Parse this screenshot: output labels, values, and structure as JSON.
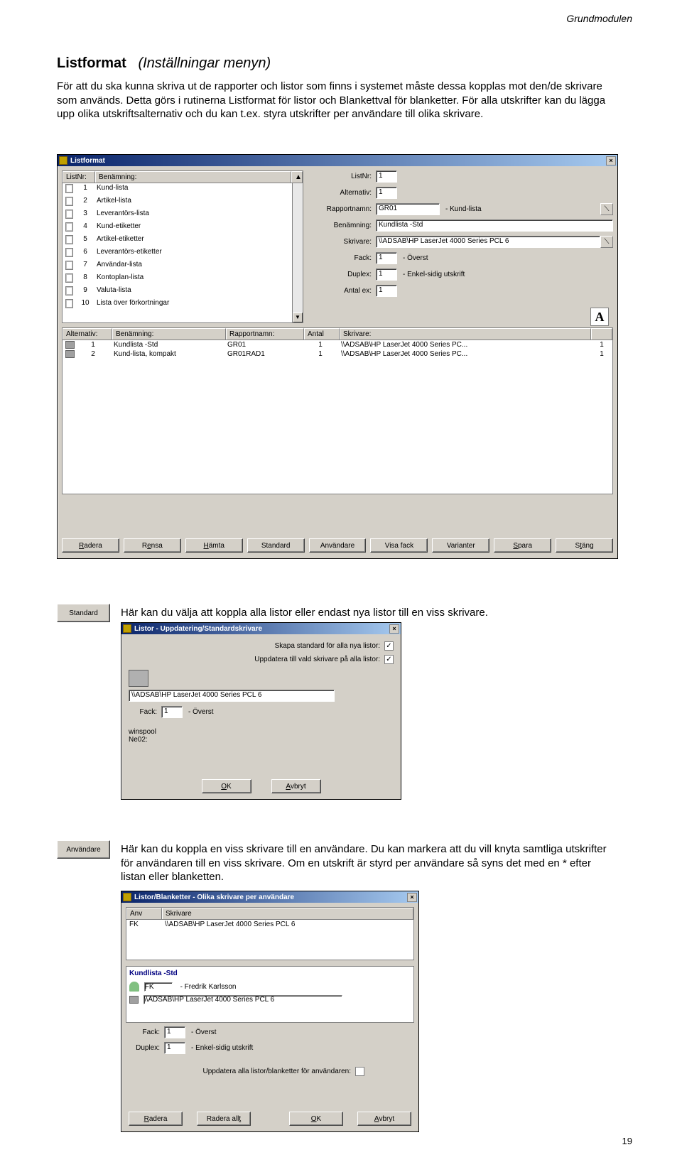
{
  "header": "Grundmodulen",
  "page_number": "19",
  "title": {
    "main": "Listformat",
    "paren": "(Inställningar menyn)"
  },
  "para1": "För att du ska kunna skriva ut de rapporter och listor som finns i systemet måste dessa kopplas mot den/de skrivare som används. Detta görs i rutinerna Listformat för listor och Blankettval för blanketter. För alla utskrifter kan du lägga upp olika utskriftsalternativ och du kan t.ex. styra utskrifter per användare till olika skrivare.",
  "para2": "Här kan du välja att koppla alla listor eller endast nya listor till en viss skrivare.",
  "para3": "Här kan du koppla en viss skrivare till en användare. Du kan markera att du vill knyta samtliga utskrifter för användaren till en viss skrivare. Om en utskrift är styrd per användare så syns det med en * efter listan eller blanketten.",
  "badge_standard": "Standard",
  "badge_anvandare": "Användare",
  "win1": {
    "title": "Listformat",
    "list_head": [
      "ListNr:",
      "Benämning:"
    ],
    "list_rows": [
      [
        "1",
        "Kund-lista"
      ],
      [
        "2",
        "Artikel-lista"
      ],
      [
        "3",
        "Leverantörs-lista"
      ],
      [
        "4",
        "Kund-etiketter"
      ],
      [
        "5",
        "Artikel-etiketter"
      ],
      [
        "6",
        "Leverantörs-etiketter"
      ],
      [
        "7",
        "Användar-lista"
      ],
      [
        "8",
        "Kontoplan-lista"
      ],
      [
        "9",
        "Valuta-lista"
      ],
      [
        "10",
        "Lista över förkortningar"
      ]
    ],
    "form": {
      "listnr_lbl": "ListNr:",
      "listnr_val": "1",
      "alternativ_lbl": "Alternativ:",
      "alternativ_val": "1",
      "rapportnamn_lbl": "Rapportnamn:",
      "rapportnamn_val": "GR01",
      "rapportnamn_desc": "- Kund-lista",
      "benamning_lbl": "Benämning:",
      "benamning_val": "Kundlista -Std",
      "skrivare_lbl": "Skrivare:",
      "skrivare_val": "\\\\ADSAB\\HP LaserJet 4000 Series PCL 6",
      "fack_lbl": "Fack:",
      "fack_val": "1",
      "fack_desc": "- Överst",
      "duplex_lbl": "Duplex:",
      "duplex_val": "1",
      "duplex_desc": "- Enkel-sidig utskrift",
      "antal_lbl": "Antal ex:",
      "antal_val": "1"
    },
    "grid2_head": [
      "Alternativ:",
      "Benämning:",
      "Rapportnamn:",
      "Antal",
      "Skrivare:"
    ],
    "grid2_rows": [
      [
        "1",
        "Kundlista -Std",
        "GR01",
        "1",
        "\\\\ADSAB\\HP LaserJet 4000 Series PC...",
        "1"
      ],
      [
        "2",
        "Kund-lista, kompakt",
        "GR01RAD1",
        "1",
        "\\\\ADSAB\\HP LaserJet 4000 Series PC...",
        "1"
      ]
    ],
    "buttons": [
      "Radera",
      "Rensa",
      "Hämta",
      "Standard",
      "Användare",
      "Visa fack",
      "Varianter",
      "Spara",
      "Stäng"
    ]
  },
  "win2": {
    "title": "Listor - Uppdatering/Standardskrivare",
    "cb1": "Skapa standard för alla nya listor:",
    "cb2": "Uppdatera till vald skrivare på alla listor:",
    "printer": "\\\\ADSAB\\HP LaserJet 4000 Series PCL 6",
    "fack_lbl": "Fack:",
    "fack_val": "1",
    "fack_desc": "- Överst",
    "spool1": "winspool",
    "spool2": "Ne02:",
    "ok": "OK",
    "avbryt": "Avbryt"
  },
  "win3": {
    "title": "Listor/Blanketter - Olika skrivare per användare",
    "head": [
      "Anv",
      "Skrivare"
    ],
    "row": [
      "FK",
      "\\\\ADSAB\\HP LaserJet 4000 Series PCL 6"
    ],
    "mid_title": "Kundlista -Std",
    "user_code": "FK",
    "user_name": "- Fredrik Karlsson",
    "printer": "\\\\ADSAB\\HP LaserJet 4000 Series PCL 6",
    "fack_lbl": "Fack:",
    "fack_val": "1",
    "fack_desc": "- Överst",
    "duplex_lbl": "Duplex:",
    "duplex_val": "1",
    "duplex_desc": "- Enkel-sidig utskrift",
    "cb_label": "Uppdatera alla listor/blanketter för användaren:",
    "buttons": [
      "Radera",
      "Radera allt",
      "OK",
      "Avbryt"
    ]
  }
}
